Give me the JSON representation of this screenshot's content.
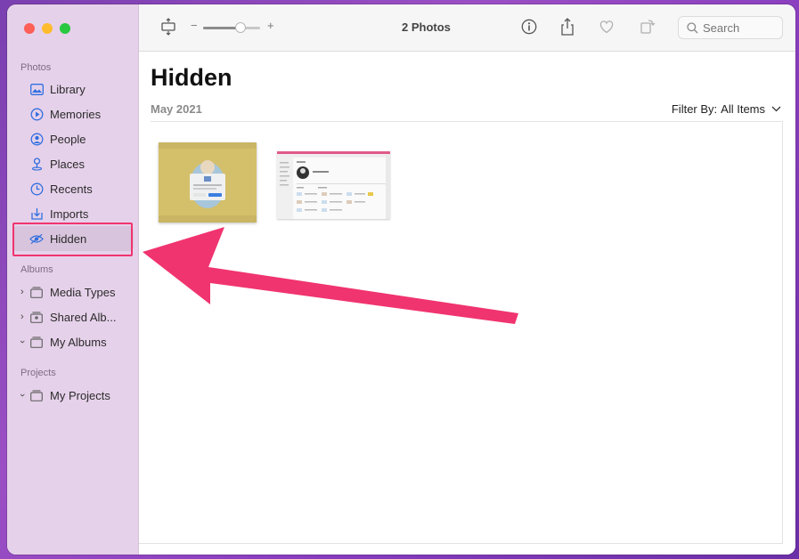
{
  "window": {
    "traffic_lights": [
      "close",
      "minimize",
      "zoom"
    ]
  },
  "sidebar": {
    "sections": {
      "photos": "Photos",
      "albums": "Albums",
      "projects": "Projects"
    },
    "items": [
      {
        "label": "Library",
        "icon": "library-icon"
      },
      {
        "label": "Memories",
        "icon": "memories-icon"
      },
      {
        "label": "People",
        "icon": "people-icon"
      },
      {
        "label": "Places",
        "icon": "places-icon"
      },
      {
        "label": "Recents",
        "icon": "clock-icon"
      },
      {
        "label": "Imports",
        "icon": "import-icon"
      },
      {
        "label": "Hidden",
        "icon": "eye-slash-icon",
        "selected": true
      }
    ],
    "albums": [
      {
        "label": "Media Types",
        "icon": "album-icon"
      },
      {
        "label": "Shared Alb...",
        "icon": "shared-album-icon"
      },
      {
        "label": "My Albums",
        "icon": "album-icon"
      }
    ],
    "projects": [
      {
        "label": "My Projects",
        "icon": "album-icon"
      }
    ]
  },
  "toolbar": {
    "title": "2 Photos",
    "zoom_minus": "−",
    "zoom_plus": "+",
    "zoom_level": 0.5,
    "search_placeholder": "Search"
  },
  "main": {
    "title": "Hidden",
    "date": "May 2021",
    "filter_label": "Filter By:",
    "filter_value": "All Items"
  },
  "colors": {
    "accent": "#2f6fe0",
    "highlight": "#f0346f",
    "sidebar_bg": "#e6d1ea"
  }
}
